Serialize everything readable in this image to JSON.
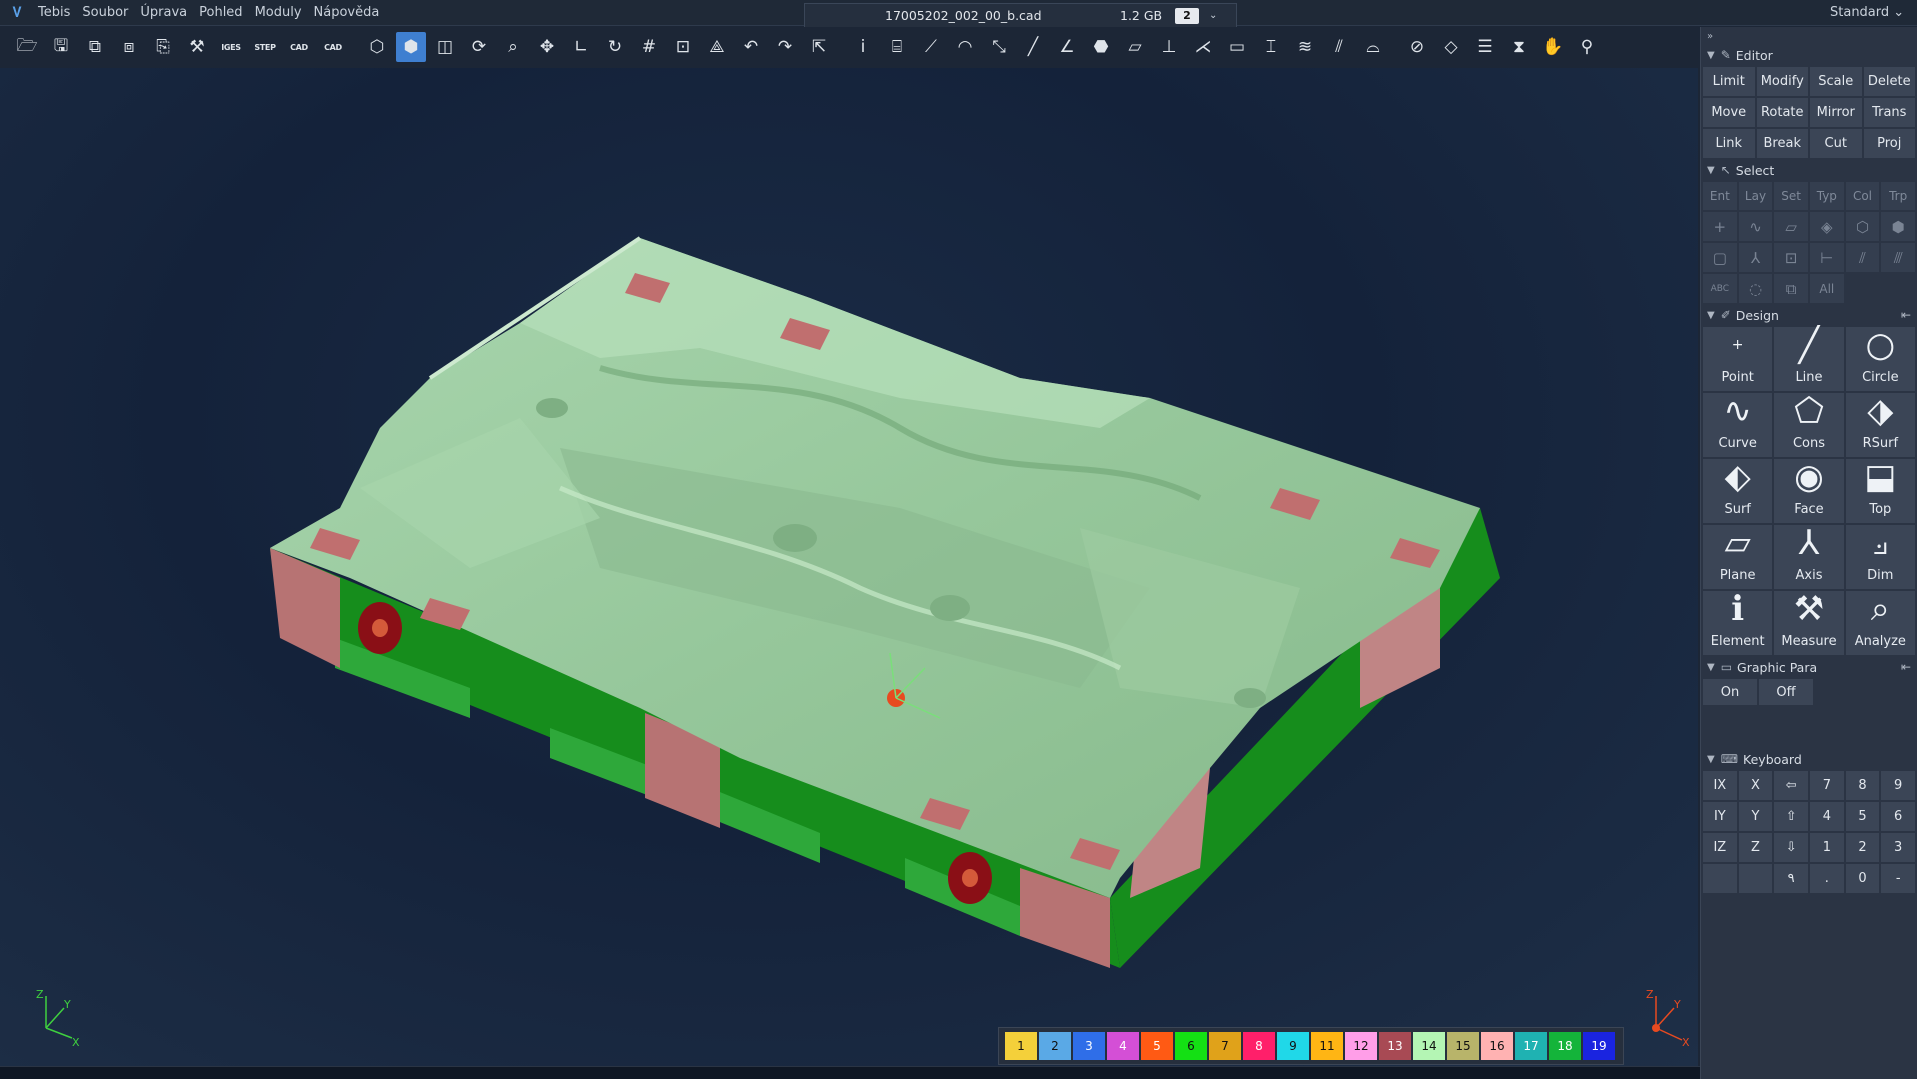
{
  "menubar": {
    "app_name": "Tebis",
    "items": [
      "Soubor",
      "Úprava",
      "Pohled",
      "Moduly",
      "Nápověda"
    ],
    "workspace": "Standard ⌄"
  },
  "file_tab": {
    "filename": "17005202_002_00_b.cad",
    "size": "1.2 GB",
    "views": "2",
    "dropdown": "⌄"
  },
  "toolbar": {
    "labels": {
      "iges": "IGES",
      "step": "STEP",
      "cad1": "CAD",
      "cad2": "CAD"
    }
  },
  "panel": {
    "editor": {
      "title": "Editor",
      "buttons": [
        "Limit",
        "Modify",
        "Scale",
        "Delete",
        "Move",
        "Rotate",
        "Mirror",
        "Trans",
        "Link",
        "Break",
        "Cut",
        "Proj"
      ]
    },
    "select": {
      "title": "Select",
      "tabs": [
        "Ent",
        "Lay",
        "Set",
        "Typ",
        "Col",
        "Trp"
      ],
      "all_label": "All",
      "abc_label": "ABC"
    },
    "design": {
      "title": "Design",
      "buttons": [
        "Point",
        "Line",
        "Circle",
        "Curve",
        "Cons",
        "RSurf",
        "Surf",
        "Face",
        "Top",
        "Plane",
        "Axis",
        "Dim",
        "Element",
        "Measure",
        "Analyze"
      ]
    },
    "graphic": {
      "title": "Graphic Para",
      "on": "On",
      "off": "Off"
    },
    "keyboard": {
      "title": "Keyboard",
      "keys": [
        "IX",
        "X",
        "⇦",
        "7",
        "8",
        "9",
        "IY",
        "Y",
        "⇧",
        "4",
        "5",
        "6",
        "IZ",
        "Z",
        "⇩",
        "1",
        "2",
        "3",
        "",
        "",
        "٩",
        ".",
        "0",
        "-"
      ]
    }
  },
  "palette": {
    "labels": [
      "1",
      "2",
      "3",
      "4",
      "5",
      "6",
      "7",
      "8",
      "9",
      "11",
      "12",
      "13",
      "14",
      "15",
      "16",
      "17",
      "18",
      "19"
    ],
    "colors": [
      "#f4d03a",
      "#5aa9e6",
      "#2f6ee8",
      "#d44fd6",
      "#ff5a14",
      "#14e014",
      "#e0a21a",
      "#ff1f6a",
      "#20d8e8",
      "#ffb514",
      "#ff9ee8",
      "#a84a54",
      "#b4f5b4",
      "#b8b46a",
      "#ffb2b2",
      "#1fb2b2",
      "#14b43a",
      "#1a24e0"
    ]
  },
  "triad": {
    "x": "X",
    "y": "Y",
    "z": "Z"
  }
}
